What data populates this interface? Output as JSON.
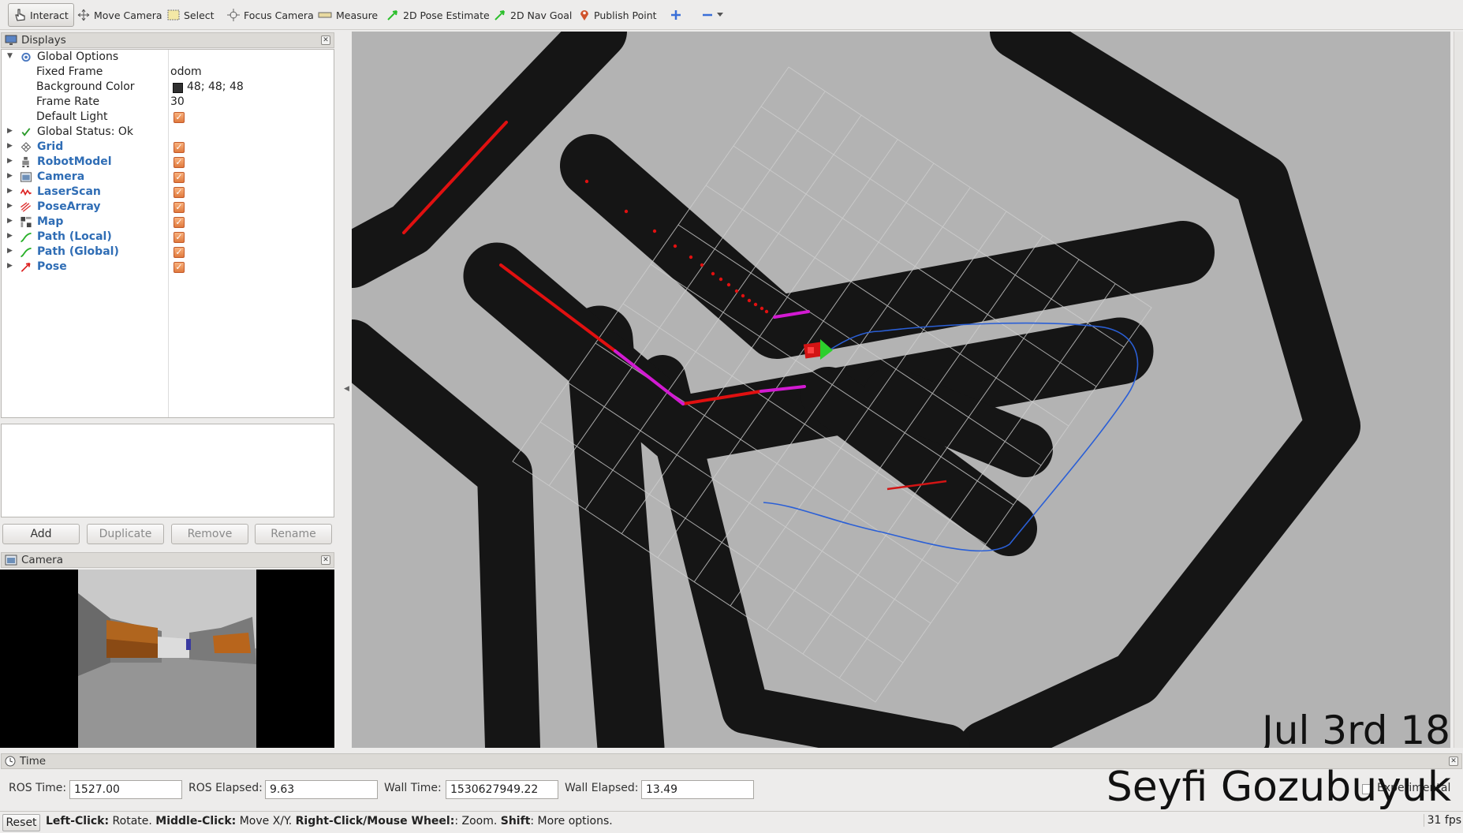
{
  "toolbar": {
    "interact": "Interact",
    "move_camera": "Move Camera",
    "select": "Select",
    "focus_camera": "Focus Camera",
    "measure": "Measure",
    "pose_estimate": "2D Pose Estimate",
    "nav_goal": "2D Nav Goal",
    "publish_point": "Publish Point"
  },
  "displays_panel": {
    "title": "Displays",
    "global_options": {
      "label": "Global Options",
      "fixed_frame_label": "Fixed Frame",
      "fixed_frame_value": "odom",
      "bg_color_label": "Background Color",
      "bg_color_value": "48; 48; 48",
      "frame_rate_label": "Frame Rate",
      "frame_rate_value": "30",
      "default_light_label": "Default Light"
    },
    "global_status": "Global Status: Ok",
    "items": [
      {
        "label": "Grid",
        "icon": "grid-icon",
        "color": "#2f6db5"
      },
      {
        "label": "RobotModel",
        "icon": "robot-icon"
      },
      {
        "label": "Camera",
        "icon": "camera-icon"
      },
      {
        "label": "LaserScan",
        "icon": "laserscan-icon"
      },
      {
        "label": "PoseArray",
        "icon": "posearray-icon"
      },
      {
        "label": "Map",
        "icon": "map-icon"
      },
      {
        "label": "Path (Local)",
        "icon": "path-icon"
      },
      {
        "label": "Path (Global)",
        "icon": "path-icon"
      },
      {
        "label": "Pose",
        "icon": "pose-icon"
      }
    ],
    "buttons": {
      "add": "Add",
      "duplicate": "Duplicate",
      "remove": "Remove",
      "rename": "Rename"
    }
  },
  "camera_panel": {
    "title": "Camera"
  },
  "time_panel": {
    "title": "Time",
    "ros_time_label": "ROS Time:",
    "ros_time_value": "1527.00",
    "ros_elapsed_label": "ROS Elapsed:",
    "ros_elapsed_value": "9.63",
    "wall_time_label": "Wall Time:",
    "wall_time_value": "1530627949.22",
    "wall_elapsed_label": "Wall Elapsed:",
    "wall_elapsed_value": "13.49",
    "experimental_label": "Experimental"
  },
  "status_bar": {
    "reset": "Reset",
    "left_click": "Left-Click:",
    "left_click_desc": " Rotate. ",
    "middle_click": "Middle-Click:",
    "middle_click_desc": " Move X/Y. ",
    "right_click": "Right-Click/Mouse Wheel:",
    "right_click_desc": ": Zoom. ",
    "shift": "Shift",
    "shift_desc": ": More options.",
    "fps": "31 fps"
  },
  "overlay": {
    "date": "Jul 3rd 18",
    "author": "Seyfi Gozubuyuk"
  }
}
